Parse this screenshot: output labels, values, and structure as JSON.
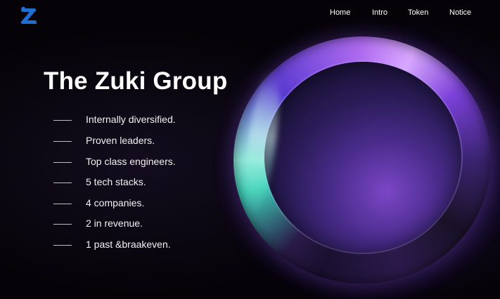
{
  "brand": {
    "logo_icon": "zuki-z-logo-icon",
    "accent_color": "#1f6fd1"
  },
  "nav": {
    "items": [
      {
        "label": "Home"
      },
      {
        "label": "Intro"
      },
      {
        "label": "Token"
      },
      {
        "label": "Notice"
      }
    ]
  },
  "hero": {
    "title": "The Zuki Group",
    "features": [
      "Internally diversified.",
      "Proven leaders.",
      "Top class engineers.",
      "5 tech stacks.",
      "4 companies.",
      "2 in revenue.",
      "1 past &braakeven."
    ],
    "ring_colors": [
      "#3cd0b8",
      "#b06cf0",
      "#7b46c6"
    ]
  }
}
